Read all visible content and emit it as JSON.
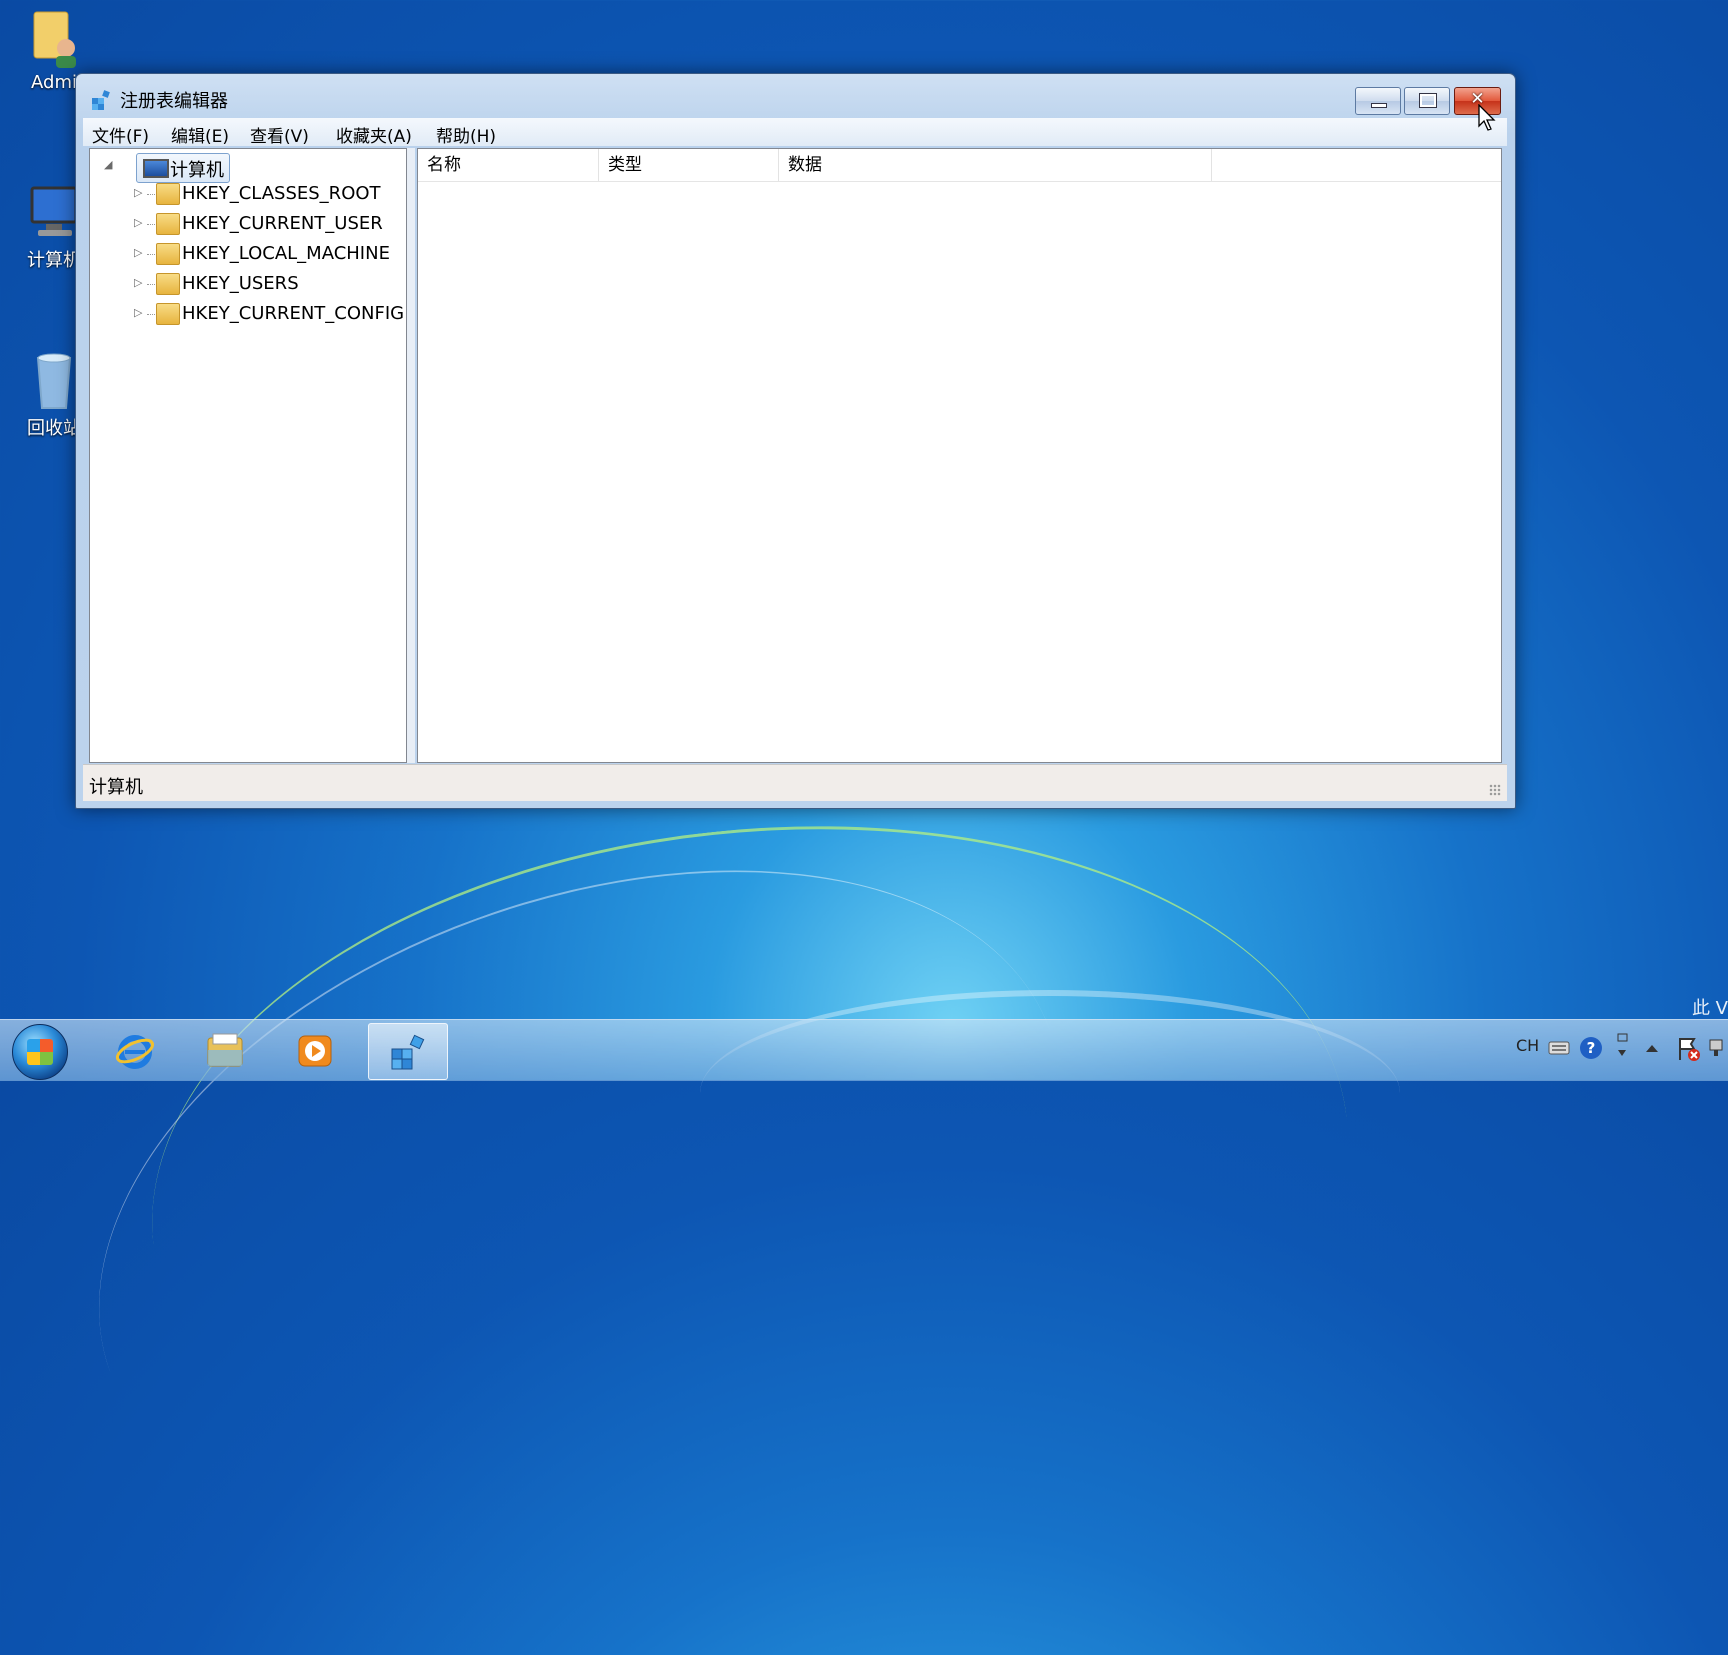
{
  "desktop": {
    "icons": [
      {
        "label": "Admi",
        "icon": "user-folder-icon"
      },
      {
        "label": "计算机",
        "icon": "computer-icon"
      },
      {
        "label": "回收站",
        "icon": "recycle-bin-icon"
      }
    ],
    "watermark": "此 V"
  },
  "window": {
    "title": "注册表编辑器",
    "icon": "regedit-icon",
    "close_glyph": "✕",
    "menu": [
      "文件(F)",
      "编辑(E)",
      "查看(V)",
      "收藏夹(A)",
      "帮助(H)"
    ],
    "tree": {
      "root": "计算机",
      "root_expander": "◢",
      "keys": [
        {
          "label": "HKEY_CLASSES_ROOT",
          "expander": "▷"
        },
        {
          "label": "HKEY_CURRENT_USER",
          "expander": "▷"
        },
        {
          "label": "HKEY_LOCAL_MACHINE",
          "expander": "▷"
        },
        {
          "label": "HKEY_USERS",
          "expander": "▷"
        },
        {
          "label": "HKEY_CURRENT_CONFIG",
          "expander": "▷"
        }
      ]
    },
    "list_columns": [
      "名称",
      "类型",
      "数据"
    ],
    "status": "计算机"
  },
  "taskbar": {
    "apps": [
      {
        "icon": "internet-explorer-icon",
        "color": "#1f7be0"
      },
      {
        "icon": "file-explorer-icon",
        "color": "#e8c15a"
      },
      {
        "icon": "media-player-icon",
        "color": "#f08a1d"
      },
      {
        "icon": "regedit-icon",
        "color": "#3a8fd6",
        "active": true
      }
    ],
    "tray": {
      "language": "CH",
      "help_glyph": "?"
    }
  }
}
